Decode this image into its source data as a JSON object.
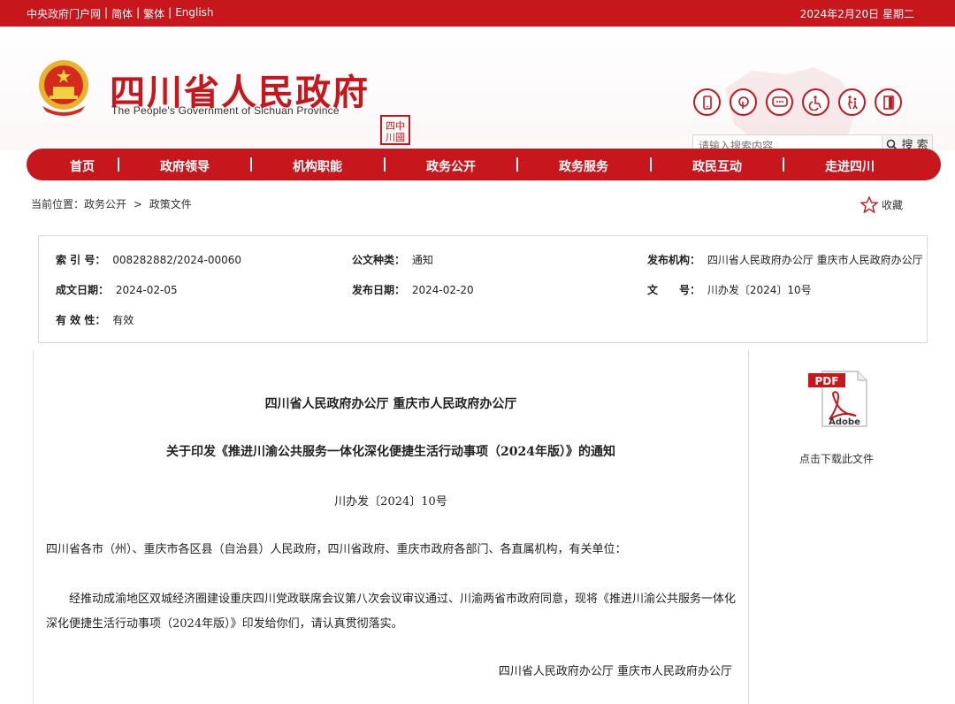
{
  "topbar": {
    "links": [
      "中央政府门户网",
      "简体",
      "繁体",
      "English"
    ],
    "date": "2024年2月20日 星期二"
  },
  "header": {
    "title": "四川省人民政府",
    "subtitle": "The People's Government of Sichuan Province",
    "seal_text": "四川中國",
    "icons": [
      "mobile-icon",
      "weibo-icon",
      "wechat-icon",
      "accessibility-icon",
      "elder-care-icon",
      "exit-icon"
    ]
  },
  "search": {
    "placeholder": "请输入搜索内容",
    "button": "搜 索"
  },
  "nav": {
    "items": [
      "首页",
      "政府领导",
      "机构职能",
      "政务公开",
      "政务服务",
      "政民互动",
      "走进四川"
    ]
  },
  "breadcrumb": {
    "prefix": "当前位置：",
    "level1": "政务公开",
    "sep": ">",
    "level2": "政策文件"
  },
  "favorite_label": "收藏",
  "meta": {
    "index_label": "索 引 号：",
    "index_value": "008282882/2024-00060",
    "type_label": "公文种类：",
    "type_value": "通知",
    "publisher_label": "发布机构：",
    "publisher_value": "四川省人民政府办公厅 重庆市人民政府办公厅",
    "created_label": "成文日期：",
    "created_value": "2024-02-05",
    "published_label": "发布日期：",
    "published_value": "2024-02-20",
    "docno_label": "文　　号：",
    "docno_value": "川办发〔2024〕10号",
    "validity_label": "有 效 性：",
    "validity_value": "有效"
  },
  "document": {
    "issuer": "四川省人民政府办公厅 重庆市人民政府办公厅",
    "title": "关于印发《推进川渝公共服务一体化深化便捷生活行动事项（2024年版）》的通知",
    "number": "川办发〔2024〕10号",
    "addressee": "四川省各市（州）、重庆市各区县（自治县）人民政府，四川省政府、重庆市政府各部门、各直属机构，有关单位：",
    "body": "经推动成渝地区双城经济圈建设重庆四川党政联席会议第八次会议审议通过、川渝两省市政府同意，现将《推进川渝公共服务一体化深化便捷生活行动事项（2024年版）》印发给你们，请认真贯彻落实。",
    "signer": "四川省人民政府办公厅  重庆市人民政府办公厅"
  },
  "download": {
    "badge": "PDF",
    "brand": "Adobe",
    "label": "点击下载此文件"
  }
}
